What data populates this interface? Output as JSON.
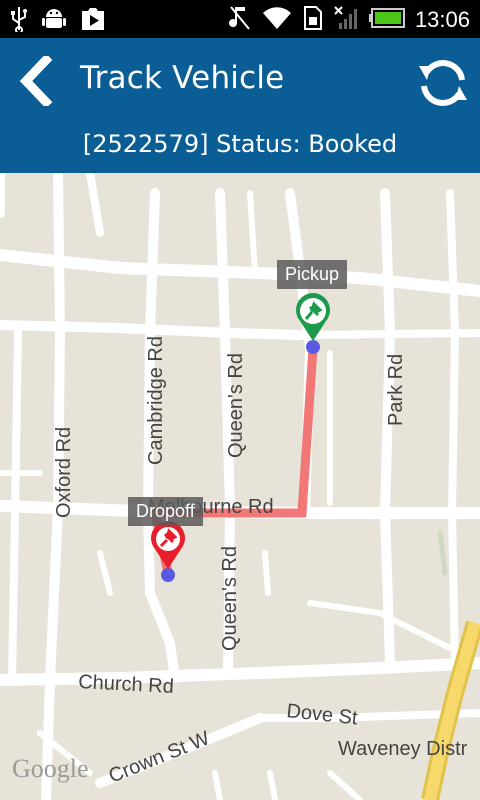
{
  "status_bar": {
    "time": "13:06",
    "icons": [
      "usb-icon",
      "android-debug-icon",
      "play-store-icon",
      "mute-icon",
      "wifi-icon",
      "sim-icon",
      "no-signal-icon",
      "battery-icon"
    ]
  },
  "header": {
    "title": "Track Vehicle",
    "subtitle": "[2522579] Status: Booked",
    "accent": "#0a5d95"
  },
  "map": {
    "pickup_label": "Pickup",
    "dropoff_label": "Dropoff",
    "route_color": "#f06060",
    "pickup_color": "#1a9a4a",
    "dropoff_color": "#e81e2a",
    "attribution": "Google",
    "roads": {
      "melbourne": "Melbourne Rd",
      "cambridge": "Cambridge Rd",
      "queens_upper": "Queen's Rd",
      "queens_lower": "Queen's Rd",
      "oxford": "Oxford Rd",
      "park": "Park Rd",
      "church": "Church Rd",
      "dove": "Dove St",
      "crown": "Crown St W",
      "waveney": "Waveney Distr"
    }
  }
}
